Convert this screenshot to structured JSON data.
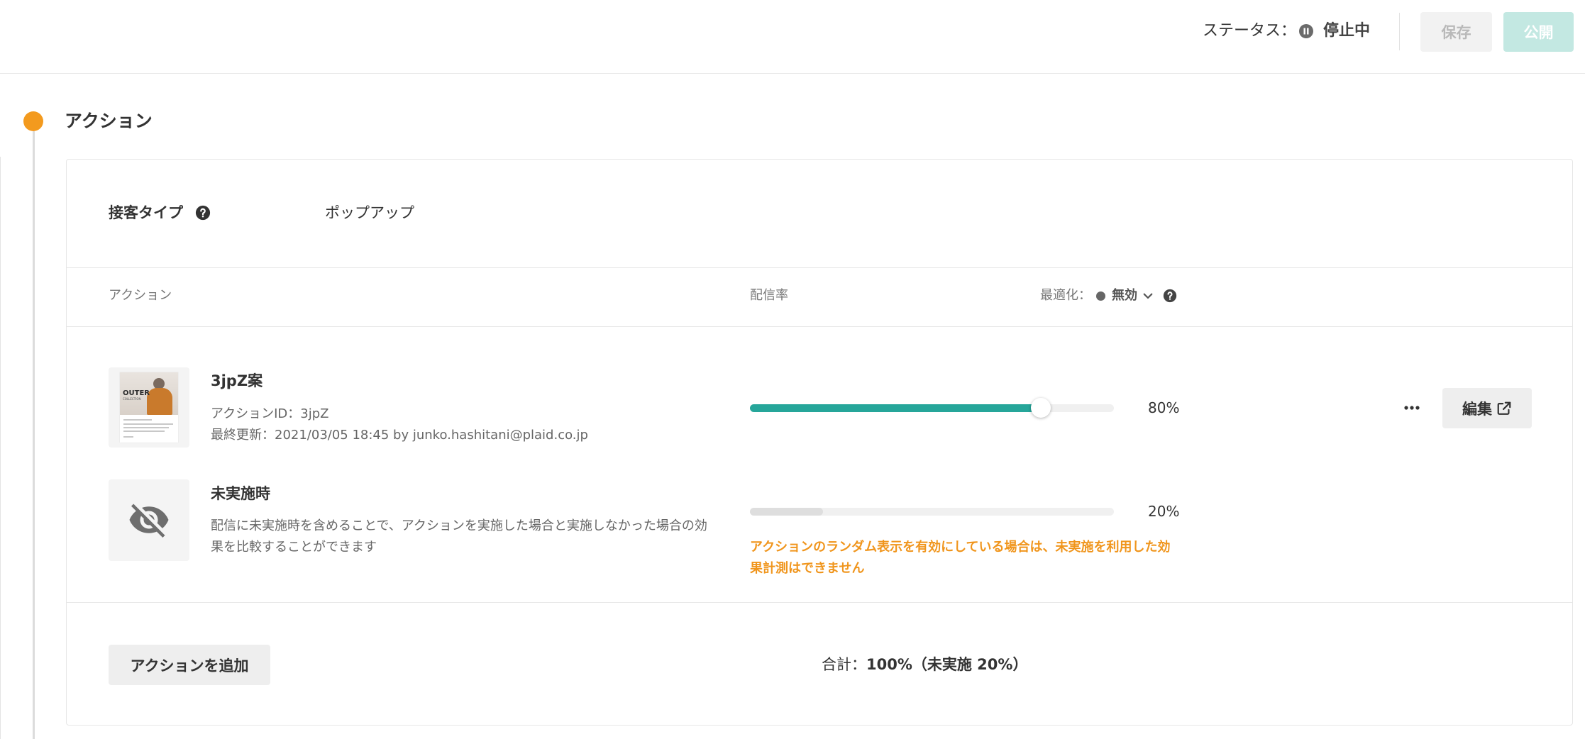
{
  "header": {
    "status_label": "ステータス：",
    "status_icon": "pause-circle-icon",
    "status_value": "停止中",
    "save_label": "保存",
    "publish_label": "公開"
  },
  "section": {
    "title": "アクション"
  },
  "customer_type": {
    "label": "接客タイプ",
    "help_icon": "question-circle-icon",
    "value": "ポップアップ"
  },
  "table_header": {
    "action": "アクション",
    "rate": "配信率",
    "optimize_label": "最適化：",
    "optimize_value": "無効",
    "optimize_icon": "chevron-down-icon",
    "help_icon": "question-circle-icon"
  },
  "actions": [
    {
      "thumbnail": {
        "headline": "OUTER",
        "subline": "COLLECTION"
      },
      "name": "3jpZ案",
      "id_line": "アクションID：3jpZ",
      "updated_line": "最終更新：2021/03/05 18:45 by junko.hashitani@plaid.co.jp",
      "rate": 80,
      "rate_label": "80%",
      "more_icon": "more-horizontal-icon",
      "edit_label": "編集",
      "edit_icon": "external-link-icon"
    }
  ],
  "control": {
    "icon": "eye-off-icon",
    "name": "未実施時",
    "description": "配信に未実施時を含めることで、アクションを実施した場合と実施しなかった場合の効果を比較することができます",
    "rate": 20,
    "rate_label": "20%",
    "warning": "アクションのランダム表示を有効にしている場合は、未実施を利用した効果計測はできません"
  },
  "footer": {
    "add_label": "アクションを追加",
    "total_label": "合計：",
    "total_value": "100%（未実施 20%）"
  },
  "colors": {
    "accent": "#26a69a",
    "timeline_dot": "#f39a1e",
    "warning": "#f0951c"
  }
}
